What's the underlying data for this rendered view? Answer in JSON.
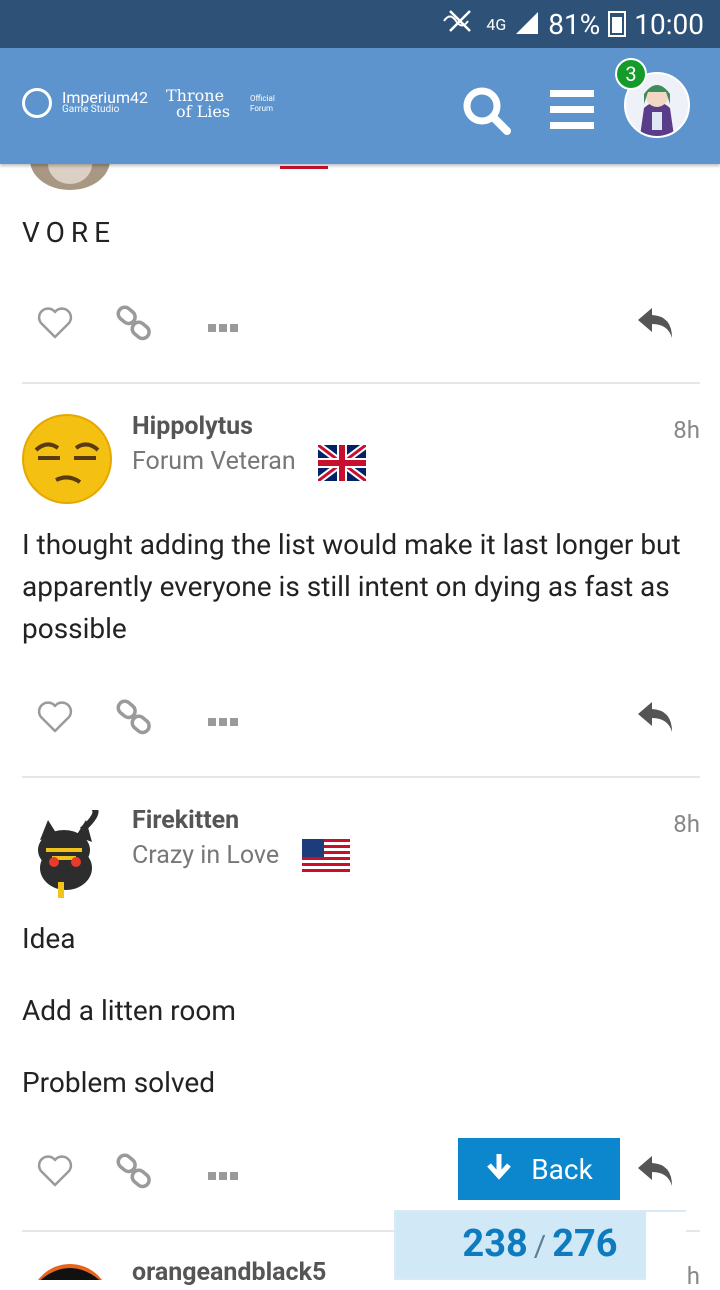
{
  "status_bar": {
    "network": "4G",
    "battery": "81%",
    "time": "10:00"
  },
  "header": {
    "logo_name": "Imperium42",
    "logo_sub": "Game Studio",
    "throne_line1": "Throne",
    "throne_line2": "of Lies",
    "official_line1": "Official",
    "official_line2": "Forum",
    "notification_count": "3"
  },
  "posts": [
    {
      "body": "VORE"
    },
    {
      "author": "Hippolytus",
      "title": "Forum Veteran",
      "time": "8h",
      "body": "I thought adding the list would make it last longer but apparently everyone is still intent on dying as fast as possible"
    },
    {
      "author": "Firekitten",
      "title": "Crazy in Love",
      "time": "8h",
      "body_lines": [
        "Idea",
        "Add a litten room",
        "Problem solved"
      ]
    },
    {
      "author": "orangeandblack5",
      "time": "h"
    }
  ],
  "back_button": {
    "label": "Back"
  },
  "progress": {
    "current": "238",
    "separator": "/",
    "total": "276"
  }
}
